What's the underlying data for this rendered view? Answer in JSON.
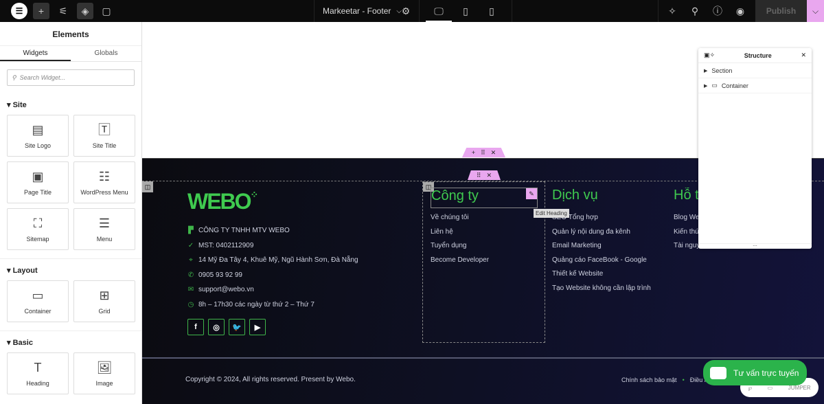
{
  "topbar": {
    "title": "Markeetar - Footer",
    "publish": "Publish",
    "icons": [
      "elementor-logo-icon",
      "plus-icon",
      "sliders-icon",
      "layers-icon",
      "comment-icon",
      "settings-icon",
      "desktop-icon",
      "tablet-icon",
      "mobile-icon",
      "notes-icon",
      "search-icon",
      "help-icon",
      "eye-icon",
      "chevron-down-icon"
    ]
  },
  "panel": {
    "title": "Elements",
    "tabs": [
      "Widgets",
      "Globals"
    ],
    "search_placeholder": "Search Widget...",
    "categories": [
      {
        "name": "Site",
        "widgets": [
          "Site Logo",
          "Site Title",
          "Page Title",
          "WordPress Menu",
          "Sitemap",
          "Menu"
        ]
      },
      {
        "name": "Layout",
        "widgets": [
          "Container",
          "Grid"
        ]
      },
      {
        "name": "Basic",
        "widgets": [
          "Heading",
          "Image"
        ]
      }
    ]
  },
  "footer": {
    "logo": "WEBO",
    "info": [
      "CÔNG TY TNHH MTV WEBO",
      "MST: 0402112909",
      "14 Mỹ Đa Tây 4, Khuê Mỹ, Ngũ Hành Sơn, Đà Nẵng",
      "0905 93 92 99",
      "support@webo.vn",
      "8h – 17h30 các ngày từ thứ 2 – Thứ 7"
    ],
    "social": [
      "f",
      "◎",
      "🐦",
      "▶"
    ],
    "col1": {
      "heading": "Công ty",
      "links": [
        "Về chúng tôi",
        "Liên hệ",
        "Tuyển dụng",
        "Become Developer"
      ]
    },
    "col2": {
      "heading": "Dịch vụ",
      "links": [
        "SEO Tổng hợp",
        "Quản lý nội dung đa kênh",
        "Email Marketing",
        "Quảng cáo FaceBook - Google",
        "Thiết kế Website",
        "Tạo Website không cần lập trình"
      ]
    },
    "col3": {
      "heading": "Hỗ t",
      "links": [
        "Blog We",
        "Kiến thứ",
        "Tài nguy"
      ]
    },
    "tooltip": "Edit Heading",
    "copyright": "Copyright © 2024, All rights reserved. Present by Webo.",
    "bottom_links": [
      "Chính sách bảo mật",
      "Điều k"
    ]
  },
  "structure": {
    "title": "Structure",
    "items": [
      "Section",
      "Container"
    ],
    "more": "..."
  },
  "chat": {
    "label": "Tư vấn trực tuyến"
  },
  "jumper": {
    "label": "JUMPER"
  },
  "colors": {
    "accent": "#e9a7ef",
    "green": "#3fca4f",
    "footer_bg": "#0e1024"
  }
}
